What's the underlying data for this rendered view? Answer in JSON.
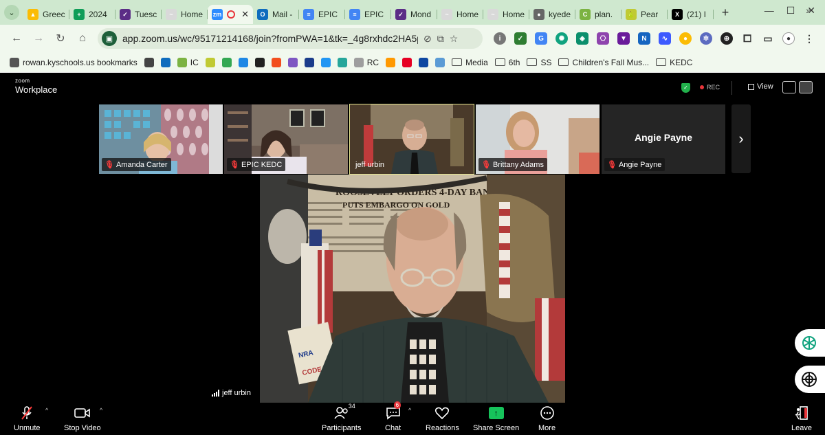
{
  "browser": {
    "tabs": [
      {
        "title": "Greec",
        "fav_color": "#fbbc04",
        "fav_char": "▲"
      },
      {
        "title": "2024",
        "fav_color": "#0f9d58",
        "fav_char": "+"
      },
      {
        "title": "Tuesc",
        "fav_color": "#5b2d86",
        "fav_char": "✓"
      },
      {
        "title": "Home",
        "fav_color": "#d9d9d9",
        "fav_char": "~"
      },
      {
        "title": "",
        "fav_color": "#2d8cff",
        "fav_char": "zm",
        "active": true
      },
      {
        "title": "Mail -",
        "fav_color": "#0f6cbd",
        "fav_char": "O"
      },
      {
        "title": "EPIC",
        "fav_color": "#4285f4",
        "fav_char": "≡"
      },
      {
        "title": "EPIC",
        "fav_color": "#4285f4",
        "fav_char": "≡"
      },
      {
        "title": "Mond",
        "fav_color": "#5b2d86",
        "fav_char": "✓"
      },
      {
        "title": "Home",
        "fav_color": "#d9d9d9",
        "fav_char": "~"
      },
      {
        "title": "Home",
        "fav_color": "#d9d9d9",
        "fav_char": "~"
      },
      {
        "title": "kyede",
        "fav_color": "#666666",
        "fav_char": "●"
      },
      {
        "title": "plan.",
        "fav_color": "#7cb342",
        "fav_char": "C"
      },
      {
        "title": "Pear",
        "fav_color": "#c0ca33",
        "fav_char": "🍐"
      },
      {
        "title": "(21) I",
        "fav_color": "#000000",
        "fav_char": "X"
      }
    ],
    "new_tab": "+",
    "url": "app.zoom.us/wc/95171214168/join?fromPWA=1&tk=_4g8rxhdc2HA5p4POz...",
    "bookmarks": [
      {
        "label": "rowan.kyschools.us bookmarks",
        "type": "icon",
        "color": "#555555"
      },
      {
        "label": "",
        "type": "icon",
        "color": "#444444"
      },
      {
        "label": "",
        "type": "icon",
        "color": "#0f6cbd"
      },
      {
        "label": "IC",
        "type": "icon",
        "color": "#7cb342"
      },
      {
        "label": "",
        "type": "icon",
        "color": "#c0ca33"
      },
      {
        "label": "",
        "type": "icon",
        "color": "#34a853"
      },
      {
        "label": "",
        "type": "icon",
        "color": "#1e88e5"
      },
      {
        "label": "",
        "type": "icon",
        "color": "#222222"
      },
      {
        "label": "",
        "type": "icon",
        "color": "#f24e1e"
      },
      {
        "label": "",
        "type": "icon",
        "color": "#7e57c2"
      },
      {
        "label": "",
        "type": "icon",
        "color": "#1a3c8a"
      },
      {
        "label": "",
        "type": "icon",
        "color": "#2196f3"
      },
      {
        "label": "",
        "type": "icon",
        "color": "#26a69a"
      },
      {
        "label": "RC",
        "type": "icon",
        "color": "#9e9e9e"
      },
      {
        "label": "",
        "type": "icon",
        "color": "#ff9900"
      },
      {
        "label": "",
        "type": "icon",
        "color": "#e60023"
      },
      {
        "label": "",
        "type": "icon",
        "color": "#0d47a1"
      },
      {
        "label": "",
        "type": "icon",
        "color": "#5b9bd5"
      },
      {
        "label": "Media",
        "type": "folder"
      },
      {
        "label": "6th",
        "type": "folder"
      },
      {
        "label": "SS",
        "type": "folder"
      },
      {
        "label": "Children's Fall Mus...",
        "type": "folder"
      },
      {
        "label": "KEDC",
        "type": "folder"
      }
    ]
  },
  "zoom": {
    "logo_top": "zoom",
    "logo_bottom": "Workplace",
    "rec_label": "REC",
    "view_label": "View",
    "gallery": [
      {
        "name": "Amanda Carter",
        "muted": true,
        "scene": "classroom"
      },
      {
        "name": "EPIC KEDC",
        "muted": true,
        "scene": "livingroom"
      },
      {
        "name": "jeff urbin",
        "muted": false,
        "scene": "jeff",
        "active": true
      },
      {
        "name": "Brittany Adams",
        "muted": true,
        "scene": "kitchen"
      },
      {
        "name": "Angie Payne",
        "muted": true,
        "scene": "novideo",
        "display_name": "Angie Payne"
      }
    ],
    "speaker_name": "jeff urbin",
    "toolbar": {
      "unmute": "Unmute",
      "stop_video": "Stop Video",
      "participants": "Participants",
      "participants_count": "34",
      "chat": "Chat",
      "chat_badge": "6",
      "reactions": "Reactions",
      "share_screen": "Share Screen",
      "more": "More",
      "leave": "Leave"
    }
  }
}
